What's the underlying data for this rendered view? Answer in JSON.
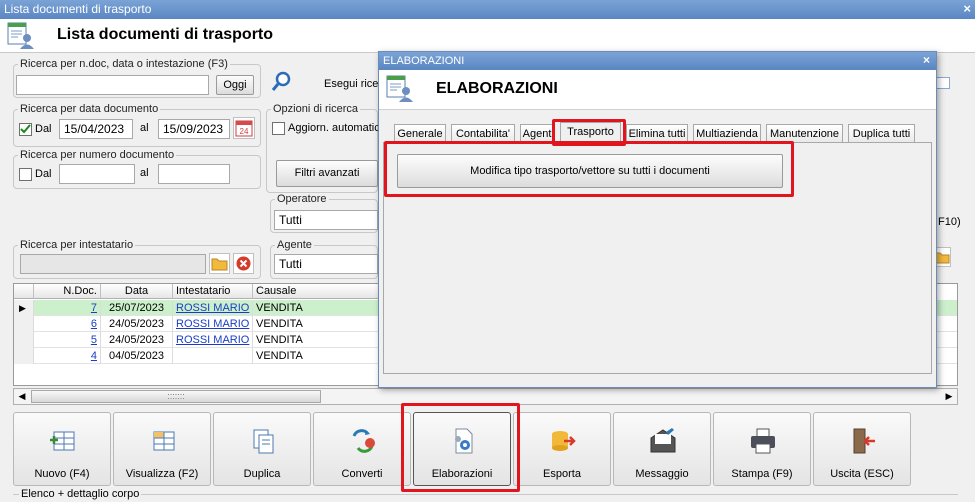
{
  "window": {
    "title": "Lista documenti di trasporto",
    "close": "×"
  },
  "header": {
    "title": "Lista documenti di trasporto"
  },
  "search": {
    "legend": "Ricerca per n.doc, data o intestazione (F3)",
    "value": "",
    "oggi_label": "Oggi",
    "esegui_label": "Esegui ricer"
  },
  "date_search": {
    "legend": "Ricerca per data documento",
    "dal_label": "Dal",
    "dal_checked": true,
    "from": "15/04/2023",
    "al_label": "al",
    "to": "15/09/2023",
    "calendar_day": "24"
  },
  "options": {
    "legend": "Opzioni di ricerca",
    "aggiorn_label": "Aggiorn. automatic",
    "filtri_label": "Filtri avanzati"
  },
  "number_search": {
    "legend": "Ricerca per numero documento",
    "dal_label": "Dal",
    "from": "",
    "al_label": "al",
    "to": ""
  },
  "operatore": {
    "legend": "Operatore",
    "value": "Tutti"
  },
  "agente": {
    "legend": "Agente",
    "value": "Tutti"
  },
  "intestatario": {
    "legend": "Ricerca per intestatario",
    "value": ""
  },
  "side_hint": "F10)",
  "grid": {
    "columns": [
      "N.Doc.",
      "Data",
      "Intestatario",
      "Causale"
    ],
    "rows": [
      {
        "num": "7",
        "date": "25/07/2023",
        "customer": "ROSSI MARIO",
        "causale": "VENDITA",
        "selected": true
      },
      {
        "num": "6",
        "date": "24/05/2023",
        "customer": "ROSSI MARIO",
        "causale": "VENDITA"
      },
      {
        "num": "5",
        "date": "24/05/2023",
        "customer": "ROSSI MARIO",
        "causale": "VENDITA"
      },
      {
        "num": "4",
        "date": "04/05/2023",
        "customer": "",
        "causale": "VENDITA"
      }
    ],
    "scroll_grip": ":::::::"
  },
  "toolbar": {
    "nuovo": "Nuovo (F4)",
    "visualizza": "Visualizza (F2)",
    "duplica": "Duplica",
    "converti": "Converti",
    "elaborazioni": "Elaborazioni",
    "esporta": "Esporta",
    "messaggio": "Messaggio",
    "stampa": "Stampa (F9)",
    "uscita": "Uscita (ESC)"
  },
  "footer_legend": "Elenco + dettaglio corpo",
  "dialog": {
    "title": "ELABORAZIONI",
    "close": "×",
    "heading": "ELABORAZIONI",
    "tabs": [
      "Generale",
      "Contabilita'",
      "Agent",
      "Trasporto",
      "Elimina tutti",
      "Multiazienda",
      "Manutenzione",
      "Duplica tutti"
    ],
    "active_tab": "Trasporto",
    "action_label": "Modifica tipo trasporto/vettore su tutti i documenti"
  },
  "colors": {
    "highlight": "#e0151d",
    "titlebar": "#6a94cc",
    "selected_row": "#ccf0cc"
  }
}
